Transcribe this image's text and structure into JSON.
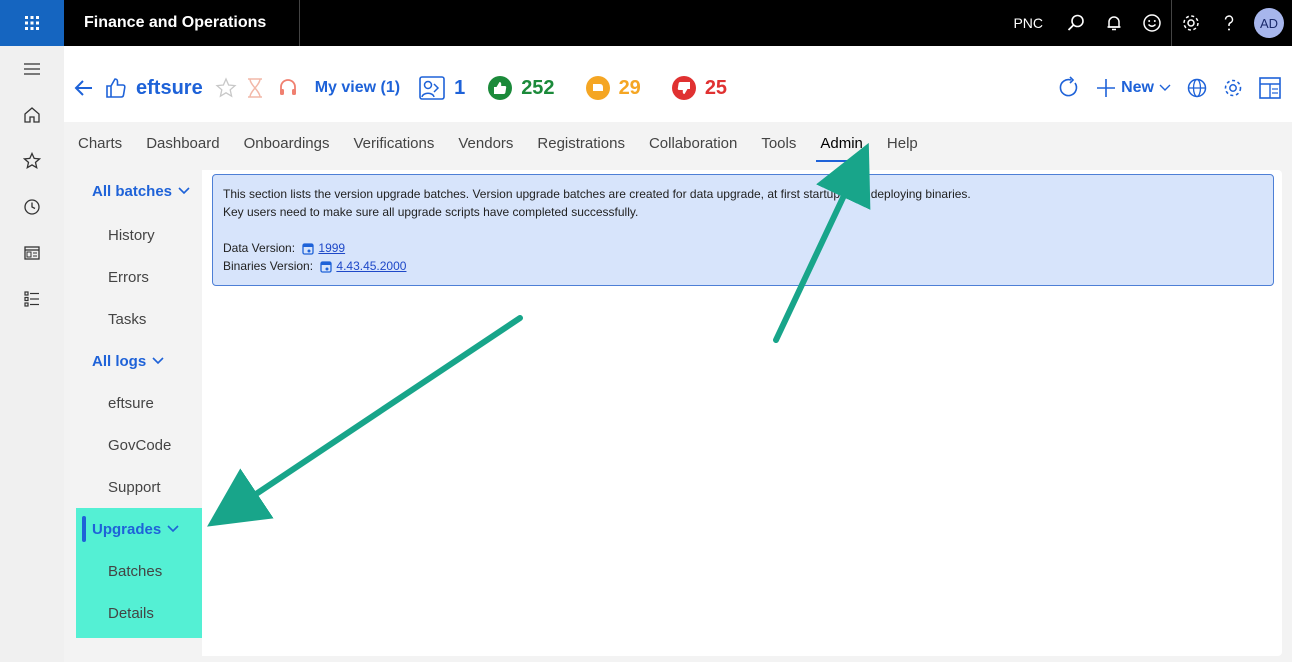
{
  "topbar": {
    "title": "Finance and Operations",
    "company": "PNC",
    "avatar_initials": "AD",
    "icons": [
      "waffle-icon",
      "search-icon",
      "bell-icon",
      "smiley-icon",
      "gear-icon",
      "help-icon"
    ]
  },
  "rail": {
    "icons": [
      "hamburger-icon",
      "home-icon",
      "star-icon",
      "clock-icon",
      "workspace-icon",
      "list-icon"
    ]
  },
  "action": {
    "app_name": "eftsure",
    "my_view": "My view (1)",
    "count_people": "1",
    "count_green": "252",
    "count_orange": "29",
    "count_red": "25",
    "new_label": "New",
    "colors": {
      "accent": "#1e62d8",
      "green": "#1b8a3a",
      "orange": "#f5a623",
      "red": "#e03131"
    }
  },
  "tabs": [
    "Charts",
    "Dashboard",
    "Onboardings",
    "Verifications",
    "Vendors",
    "Registrations",
    "Collaboration",
    "Tools",
    "Admin",
    "Help"
  ],
  "active_tab": "Admin",
  "sidenav": {
    "group_batches": "All batches",
    "history": "History",
    "errors": "Errors",
    "tasks": "Tasks",
    "group_logs": "All logs",
    "eftsure": "eftsure",
    "govcode": "GovCode",
    "support": "Support",
    "group_upgrades": "Upgrades",
    "batches": "Batches",
    "details": "Details"
  },
  "info": {
    "line1": "This section lists the version upgrade batches. Version upgrade batches are created for data upgrade, at first startup after deploying binaries.",
    "line2": "Key users need to make sure all upgrade scripts have completed successfully.",
    "data_version_label": "Data Version:",
    "data_version": "1999",
    "binaries_version_label": "Binaries Version:",
    "binaries_version": "4.43.45.2000"
  }
}
